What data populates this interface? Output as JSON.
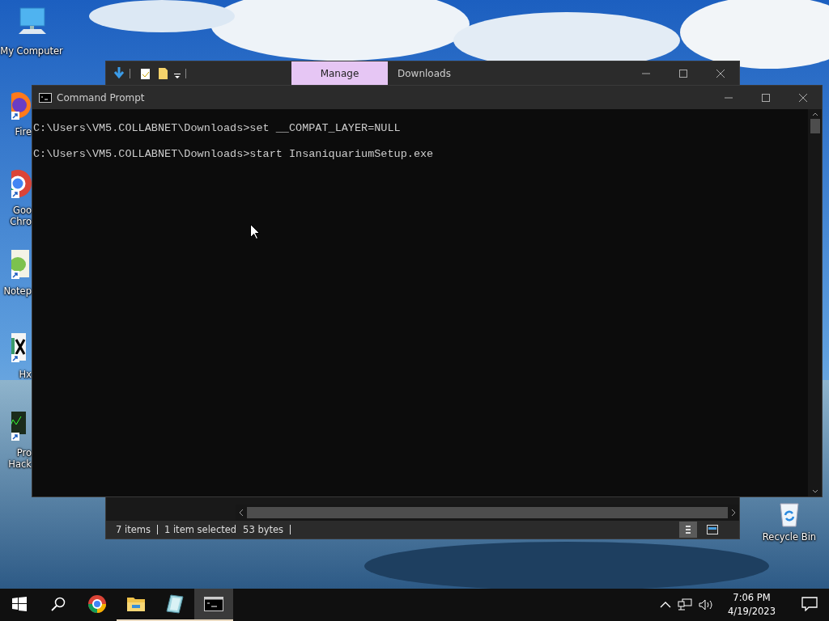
{
  "desktop_icons": [
    {
      "kind": "computer",
      "label_lines": [
        "My Computer"
      ]
    },
    {
      "kind": "firefox",
      "label_lines": [
        "Fire"
      ]
    },
    {
      "kind": "chrome",
      "label_lines": [
        "Goo",
        "Chro"
      ]
    },
    {
      "kind": "notepad",
      "label_lines": [
        "Notep"
      ]
    },
    {
      "kind": "hex",
      "label_lines": [
        "Hx"
      ]
    },
    {
      "kind": "hacker",
      "label_lines": [
        "Pro",
        "Hack"
      ]
    }
  ],
  "recycle_bin": {
    "label": "Recycle Bin"
  },
  "explorer": {
    "tabs": [
      {
        "label": "Manage",
        "selected": true
      }
    ],
    "title": "Downloads",
    "status": [
      "7 items",
      "1 item selected",
      "53 bytes"
    ],
    "views": [
      {
        "kind": "details",
        "selected": true
      },
      {
        "kind": "tiles",
        "selected": false
      }
    ]
  },
  "command_prompt": {
    "title": "Command Prompt",
    "lines": [
      "C:\\Users\\VM5.COLLABNET\\Downloads>set __COMPAT_LAYER=NULL",
      "C:\\Users\\VM5.COLLABNET\\Downloads>start InsaniquariumSetup.exe"
    ]
  },
  "taskbar": {
    "apps": [
      {
        "kind": "chrome",
        "open": false,
        "active": false
      },
      {
        "kind": "explorer",
        "open": true,
        "active": false
      },
      {
        "kind": "notepad",
        "open": true,
        "active": false
      },
      {
        "kind": "cmd",
        "open": true,
        "active": true
      }
    ],
    "time": "7:06 PM",
    "date": "4/19/2023"
  }
}
